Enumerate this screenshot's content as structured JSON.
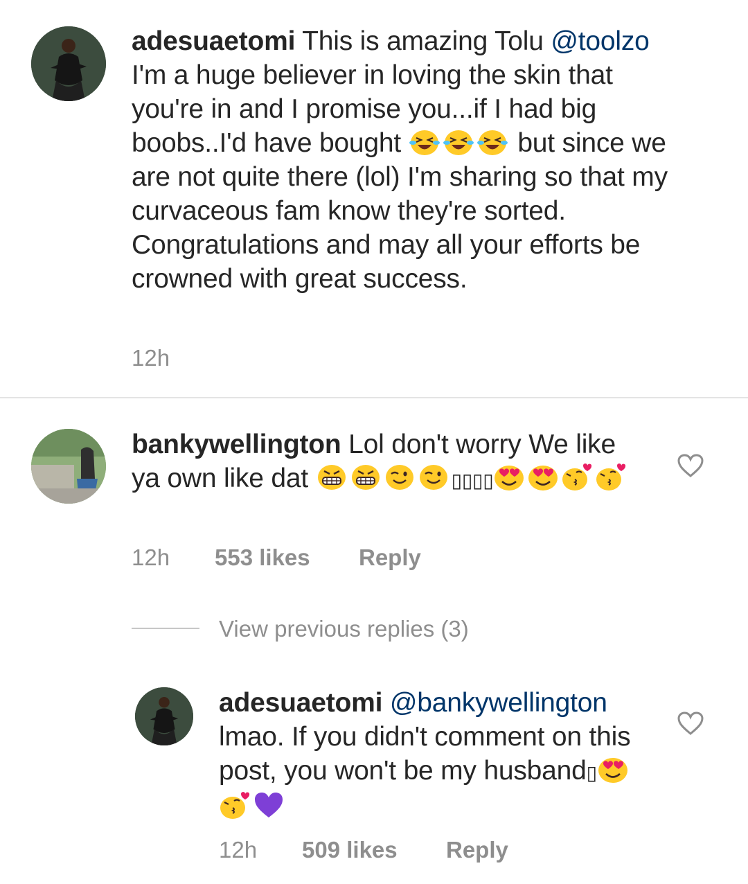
{
  "comment1": {
    "username": "adesuaetomi",
    "text_a": "This is amazing Tolu",
    "mention": "@toolzo",
    "text_b": "I'm a huge believer in loving the skin that you're in and I promise you...if I had big boobs..I'd have bought",
    "text_c": "but since we are not quite there (lol) I'm sharing so that my curvaceous fam know they're sorted. Congratulations and may all your efforts be crowned with great success.",
    "emojis": [
      "laughing-crying-face",
      "laughing-crying-face",
      "laughing-crying-face"
    ],
    "time": "12h"
  },
  "comment2": {
    "username": "bankywellington",
    "text": "Lol don't worry We like ya own like dat",
    "emojis_before_boxes": [
      "grimacing-face",
      "grimacing-face",
      "winking-face",
      "winking-face"
    ],
    "boxes": "▯▯▯▯",
    "emojis_after_boxes": [
      "smiling-face-with-heart-eyes",
      "smiling-face-with-heart-eyes",
      "face-blowing-kiss",
      "face-blowing-kiss"
    ],
    "time": "12h",
    "likes": "553 likes",
    "reply_label": "Reply"
  },
  "view_previous_replies": "View previous replies (3)",
  "reply": {
    "username": "adesuaetomi",
    "mention": "@bankywellington",
    "text": "lmao. If you didn't comment on this post, you won't be my husband",
    "box": "▯",
    "emojis": [
      "smiling-face-with-heart-eyes",
      "face-blowing-kiss",
      "purple-heart"
    ],
    "time": "12h",
    "likes": "509 likes",
    "reply_label": "Reply"
  },
  "colors": {
    "text": "#262626",
    "mention": "#003569",
    "meta": "#8e8e8e",
    "divider": "#e4e4e4",
    "emoji_yellow": "#FFCA28",
    "purple_heart": "#7E3FD6"
  }
}
